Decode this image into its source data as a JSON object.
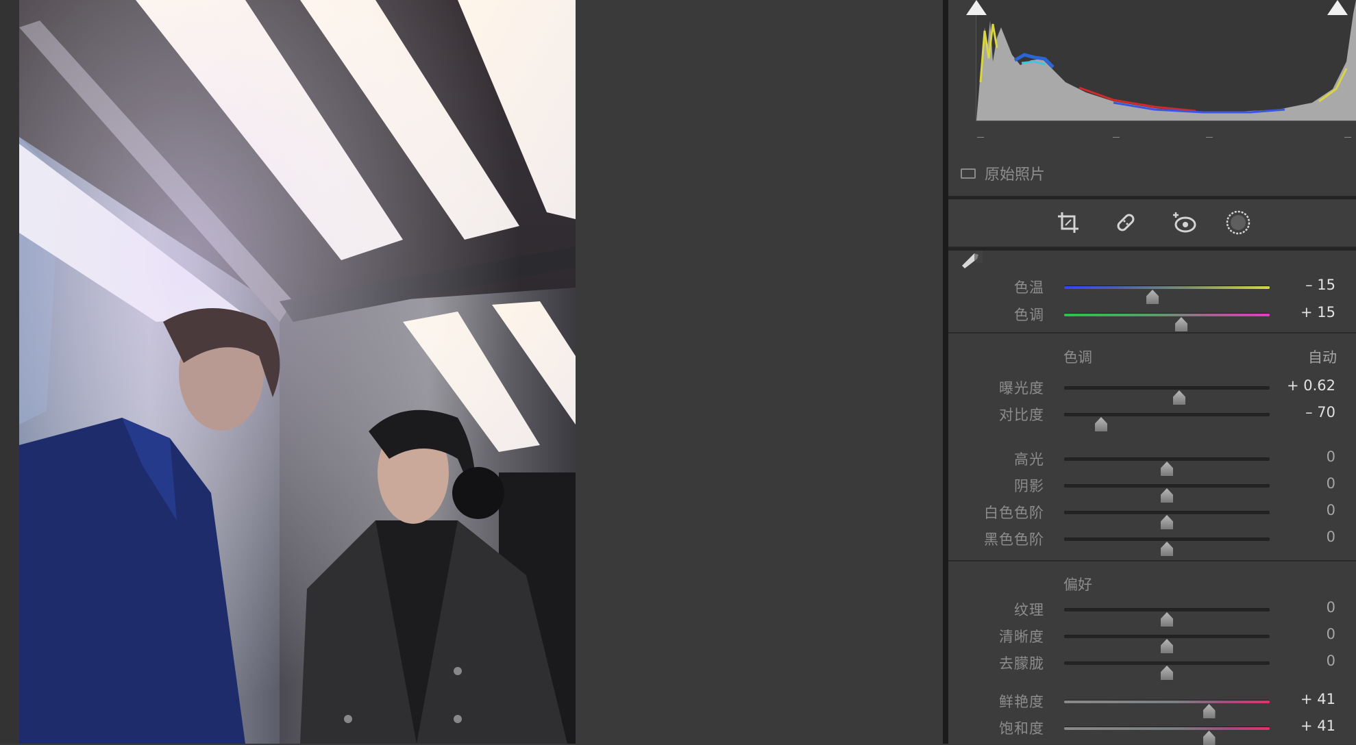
{
  "histogram": {
    "original_photo_label": "原始照片"
  },
  "toolbar": {
    "tools": [
      {
        "name": "crop-icon"
      },
      {
        "name": "healing-brush-icon"
      },
      {
        "name": "red-eye-icon"
      },
      {
        "name": "mask-icon"
      }
    ]
  },
  "white_balance": {
    "temp": {
      "label": "色温",
      "value": "– 15",
      "position": 0.43
    },
    "tint": {
      "label": "色调",
      "value": "+ 15",
      "position": 0.57
    }
  },
  "tone": {
    "title": "色调",
    "auto_label": "自动",
    "exposure": {
      "label": "曝光度",
      "value": "+ 0.62",
      "position": 0.56
    },
    "contrast": {
      "label": "对比度",
      "value": "– 70",
      "position": 0.18
    },
    "highlights": {
      "label": "高光",
      "value": "0",
      "position": 0.5
    },
    "shadows": {
      "label": "阴影",
      "value": "0",
      "position": 0.5
    },
    "whites": {
      "label": "白色色阶",
      "value": "0",
      "position": 0.5
    },
    "blacks": {
      "label": "黑色色阶",
      "value": "0",
      "position": 0.5
    }
  },
  "presence": {
    "title": "偏好",
    "texture": {
      "label": "纹理",
      "value": "0",
      "position": 0.5
    },
    "clarity": {
      "label": "清晰度",
      "value": "0",
      "position": 0.5
    },
    "dehaze": {
      "label": "去朦胧",
      "value": "0",
      "position": 0.5
    },
    "vibrance": {
      "label": "鲜艳度",
      "value": "+ 41",
      "position": 0.705
    },
    "saturation": {
      "label": "饱和度",
      "value": "+ 41",
      "position": 0.705
    }
  },
  "colors": {
    "panel_bg": "#3c3c3c",
    "workspace_bg": "#3a3a3a",
    "divider": "#1b1b1b"
  }
}
